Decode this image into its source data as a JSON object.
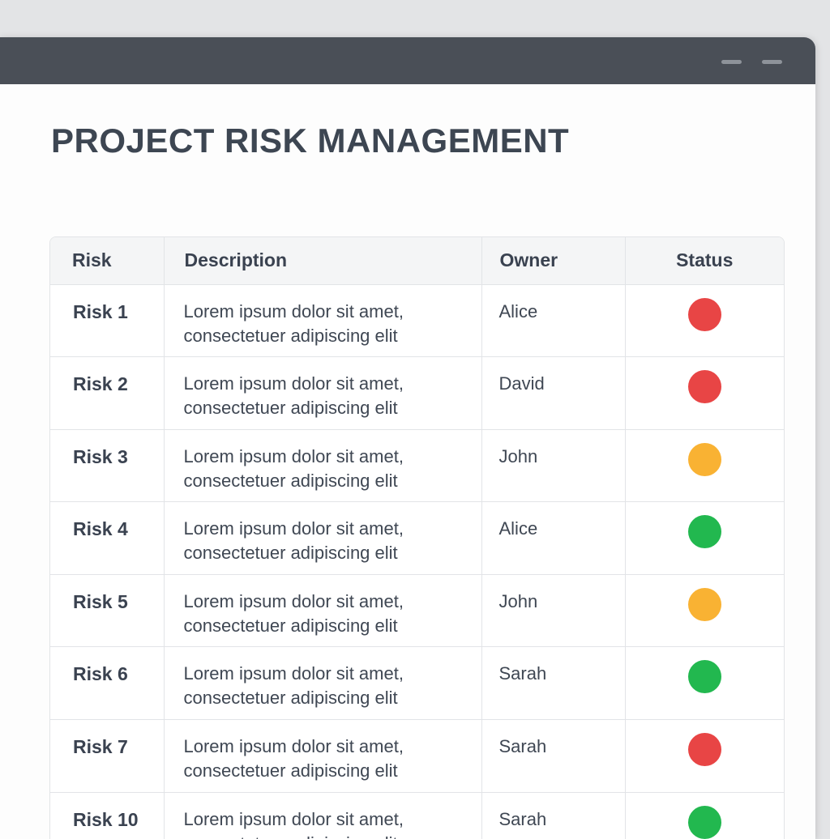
{
  "page": {
    "title": "PROJECT RISK MANAGEMENT"
  },
  "table": {
    "headers": [
      "Risk",
      "Description",
      "Owner",
      "Status"
    ],
    "rows": [
      {
        "risk": "Risk 1",
        "desc1": "Lorem ipsum dolor sit amet,",
        "desc2": "consectetuer adipiscing elit",
        "owner": "Alice",
        "status": "red"
      },
      {
        "risk": "Risk 2",
        "desc1": "Lorem ipsum dolor sit amet,",
        "desc2": "consectetuer adipiscing elit",
        "owner": "David",
        "status": "red"
      },
      {
        "risk": "Risk 3",
        "desc1": "Lorem ipsum dolor sit amet,",
        "desc2": "consectetuer adipiscing elit",
        "owner": "John",
        "status": "amber"
      },
      {
        "risk": "Risk 4",
        "desc1": "Lorem ipsum dolor sit amet,",
        "desc2": "consectetuer adipiscing elit",
        "owner": "Alice",
        "status": "green"
      },
      {
        "risk": "Risk 5",
        "desc1": "Lorem ipsum dolor sit amet,",
        "desc2": "consectetuer adipiscing elit",
        "owner": "John",
        "status": "amber"
      },
      {
        "risk": "Risk 6",
        "desc1": "Lorem ipsum dolor sit amet,",
        "desc2": "consectetuer adipiscing elit",
        "owner": "Sarah",
        "status": "green"
      },
      {
        "risk": "Risk 7",
        "desc1": "Lorem ipsum dolor sit amet,",
        "desc2": "consectetuer adipiscing elit",
        "owner": "Sarah",
        "status": "red"
      },
      {
        "risk": "Risk 10",
        "desc1": "Lorem ipsum dolor sit amet,",
        "desc2": "consectetuer adipiscing elit",
        "owner": "Sarah",
        "status": "green"
      }
    ]
  },
  "status_colors": {
    "red": "#e84545",
    "amber": "#f9b233",
    "green": "#22b84f"
  }
}
